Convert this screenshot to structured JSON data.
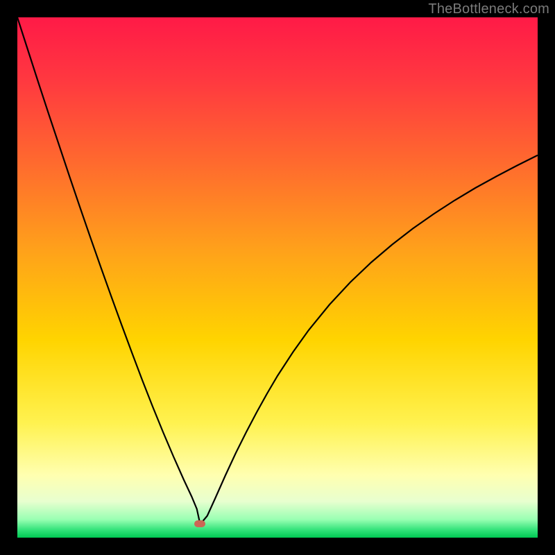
{
  "watermark": "TheBottleneck.com",
  "chart_data": {
    "type": "line",
    "title": "",
    "xlabel": "",
    "ylabel": "",
    "xlim": [
      0,
      100
    ],
    "ylim": [
      0,
      100
    ],
    "background_gradient": {
      "stops": [
        {
          "offset": 0.0,
          "color": "#ff1a47"
        },
        {
          "offset": 0.12,
          "color": "#ff3840"
        },
        {
          "offset": 0.28,
          "color": "#ff6a2e"
        },
        {
          "offset": 0.45,
          "color": "#ffa21a"
        },
        {
          "offset": 0.62,
          "color": "#ffd400"
        },
        {
          "offset": 0.78,
          "color": "#fff250"
        },
        {
          "offset": 0.88,
          "color": "#ffffb0"
        },
        {
          "offset": 0.93,
          "color": "#e8ffcf"
        },
        {
          "offset": 0.965,
          "color": "#99ffb3"
        },
        {
          "offset": 0.985,
          "color": "#33e37a"
        },
        {
          "offset": 1.0,
          "color": "#00c853"
        }
      ]
    },
    "series": [
      {
        "name": "curve",
        "color": "#000000",
        "width": 2.2,
        "x": [
          0,
          2,
          4,
          6,
          8,
          10,
          12,
          14,
          16,
          18,
          20,
          22,
          24,
          26,
          28,
          30,
          32,
          33.5,
          34.5,
          35,
          35.5,
          36.5,
          38,
          40,
          42,
          44,
          46,
          48,
          50,
          53,
          56,
          60,
          64,
          68,
          72,
          76,
          80,
          84,
          88,
          92,
          96,
          100
        ],
        "y": [
          100,
          93.8,
          87.6,
          81.5,
          75.5,
          69.5,
          63.6,
          57.8,
          52.1,
          46.5,
          41.0,
          35.6,
          30.3,
          25.2,
          20.3,
          15.6,
          11.1,
          7.9,
          5.5,
          3.2,
          3.0,
          4.2,
          7.5,
          12.0,
          16.3,
          20.3,
          24.1,
          27.7,
          31.1,
          35.7,
          39.9,
          44.8,
          49.1,
          52.9,
          56.3,
          59.4,
          62.2,
          64.8,
          67.2,
          69.4,
          71.5,
          73.5
        ]
      }
    ],
    "marker": {
      "name": "vertex-marker",
      "x": 35,
      "y": 2.7,
      "color": "#cc6655"
    }
  }
}
